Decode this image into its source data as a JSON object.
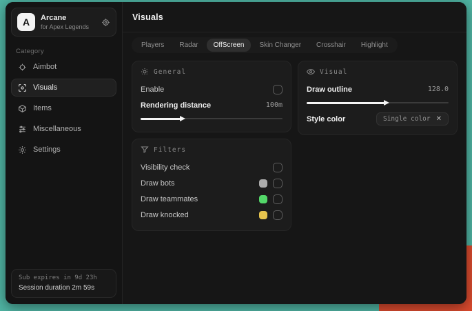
{
  "desktop": {
    "background_teal": "#4fb3a2",
    "background_red": "#d94a2e"
  },
  "sidebar": {
    "brand": {
      "logo_letter": "A",
      "title": "Arcane",
      "subtitle": "for Apex Legends",
      "gear_icon": "target-gear"
    },
    "category_label": "Category",
    "items": [
      {
        "label": "Aimbot",
        "icon": "crosshair-icon",
        "active": false
      },
      {
        "label": "Visuals",
        "icon": "eye-scan-icon",
        "active": true
      },
      {
        "label": "Items",
        "icon": "box-icon",
        "active": false
      },
      {
        "label": "Miscellaneous",
        "icon": "sliders-icon",
        "active": false
      },
      {
        "label": "Settings",
        "icon": "gear-icon",
        "active": false
      }
    ],
    "footer": {
      "sub_expires": "Sub expires in 9d 23h",
      "session_duration": "Session duration 2m 59s"
    }
  },
  "header": {
    "title": "Visuals"
  },
  "tabs": [
    {
      "label": "Players",
      "active": false
    },
    {
      "label": "Radar",
      "active": false
    },
    {
      "label": "OffScreen",
      "active": true
    },
    {
      "label": "Skin Changer",
      "active": false
    },
    {
      "label": "Crosshair",
      "active": false
    },
    {
      "label": "Highlight",
      "active": false
    }
  ],
  "general_card": {
    "title": "General",
    "enable_label": "Enable",
    "enable_checked": false,
    "rendering_label": "Rendering distance",
    "rendering_value": "100m",
    "rendering_percent": 28
  },
  "filters_card": {
    "title": "Filters",
    "rows": [
      {
        "label": "Visibility check",
        "checked": false
      },
      {
        "label": "Draw bots",
        "swatch": "#ababab",
        "checked": false
      },
      {
        "label": "Draw teammates",
        "swatch": "#53d769",
        "checked": false
      },
      {
        "label": "Draw knocked",
        "swatch": "#e6c44e",
        "checked": false
      }
    ]
  },
  "visual_card": {
    "title": "Visual",
    "outline_label": "Draw outline",
    "outline_value": "128.0",
    "outline_percent": 55,
    "style_label": "Style color",
    "style_value": "Single color",
    "clear_glyph": "✕"
  }
}
